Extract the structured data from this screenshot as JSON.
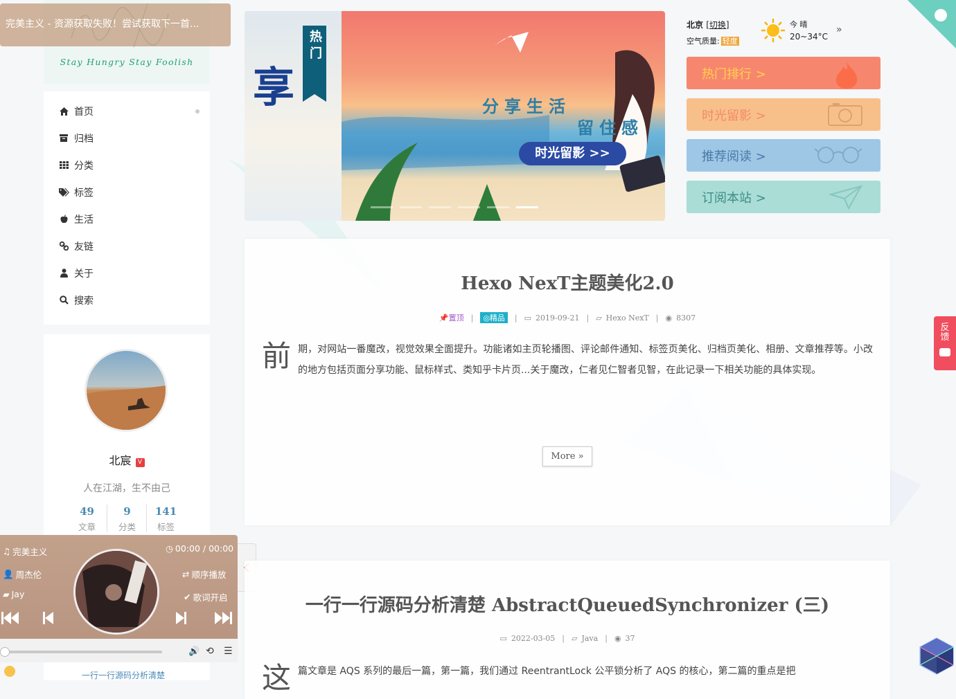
{
  "site": {
    "subtitle": "Stay Hungry Stay Foolish",
    "music_toast": "完美主义 - 资源获取失败！尝试获取下一首..."
  },
  "menu": {
    "items": [
      {
        "label": "首页",
        "icon": "home-icon"
      },
      {
        "label": "归档",
        "icon": "archive-icon"
      },
      {
        "label": "分类",
        "icon": "grid-icon"
      },
      {
        "label": "标签",
        "icon": "tags-icon"
      },
      {
        "label": "生活",
        "icon": "apple-icon"
      },
      {
        "label": "友链",
        "icon": "link-icon"
      },
      {
        "label": "关于",
        "icon": "user-icon"
      },
      {
        "label": "搜索",
        "icon": "search-icon"
      }
    ]
  },
  "profile": {
    "name": "北宸",
    "verified_badge": "V",
    "motto": "人在江湖，生不由己",
    "stats": [
      {
        "num": "49",
        "label": "文章"
      },
      {
        "num": "9",
        "label": "分类"
      },
      {
        "num": "141",
        "label": "标签"
      }
    ]
  },
  "player": {
    "song": "完美主义",
    "artist": "周杰伦",
    "album": "Jay",
    "time": "00:00 / 00:00",
    "mode": "顺序播放",
    "lyrics": "歌词开启",
    "progress": 0
  },
  "below_player_link": "一行一行源码分析清楚",
  "banner": {
    "ribbon": "热门",
    "line1": "分享生活",
    "line2": "留住感动",
    "button": "时光留影 >>",
    "left_char": "享",
    "slides": 6,
    "active_slide": 5
  },
  "weather": {
    "city": "北京",
    "switch": "[切换]",
    "aqi_label": "空气质量:",
    "aqi_value": "轻度",
    "day": "今 晴",
    "temp": "20~34°C"
  },
  "quick_links": [
    {
      "label": "热门排行 >",
      "color": "#f7866f",
      "icon": "fire-icon"
    },
    {
      "label": "时光留影 >",
      "color": "#f7c08a",
      "icon": "camera-icon"
    },
    {
      "label": "推荐阅读 >",
      "color": "#9ec7e6",
      "icon": "glasses-icon"
    },
    {
      "label": "订阅本站 >",
      "color": "#a9ddd6",
      "icon": "paper-plane-icon"
    }
  ],
  "posts": [
    {
      "title": "Hexo NexT主题美化2.0",
      "pinned": "置顶",
      "badge": "精品",
      "date": "2019-09-21",
      "category": "Hexo NexT",
      "views": "8307",
      "dropcap": "前",
      "excerpt": "期，对网站一番魔改，视觉效果全面提升。功能诸如主页轮播图、评论邮件通知、标签页美化、归档页美化、相册、文章推荐等。小改的地方包括页面分享功能、鼠标样式、类知乎卡片页...关于魔改，仁者见仁智者见智，在此记录一下相关功能的具体实现。",
      "more": "More »"
    },
    {
      "title": "一行一行源码分析清楚 AbstractQueuedSynchronizer (三)",
      "date": "2022-03-05",
      "category": "Java",
      "views": "37",
      "dropcap": "这",
      "excerpt": "篇文章是 AQS 系列的最后一篇，第一篇，我们通过 ReentrantLock 公平锁分析了 AQS 的核心，第二篇的重点是把"
    }
  ],
  "feedback": "反馈"
}
